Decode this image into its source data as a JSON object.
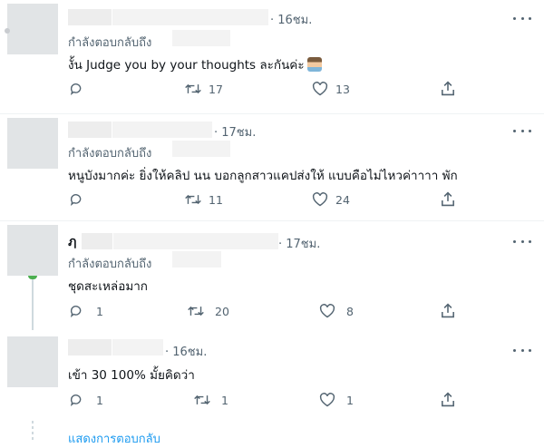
{
  "tweets": [
    {
      "time": "· 16ชม.",
      "replying_to": "กำลังตอบกลับถึง",
      "text": "งั้น Judge you by your thoughts ละกันค่ะ",
      "emoji_icon": "person-gesturing-ok-emoji",
      "replies": "",
      "retweets": "17",
      "likes": "13"
    },
    {
      "time": "· 17ชม.",
      "replying_to": "กำลังตอบกลับถึง",
      "text": "หนูบังมากค่ะ ยิ่งให้คลิป นน บอกลูกสาวแคปส่งให้ แบบคือไม่ไหวค่าาาา พัก",
      "replies": "",
      "retweets": "11",
      "likes": "24"
    },
    {
      "name_glyph": "ฦ",
      "time": "· 17ชม.",
      "replying_to": "กำลังตอบกลับถึง",
      "text": "ชุดสะเหล่อมาก",
      "replies": "1",
      "retweets": "20",
      "likes": "8"
    },
    {
      "time": "· 16ชม.",
      "text": "เข้า 30 100% มั้ยคิดว่า",
      "replies": "1",
      "retweets": "1",
      "likes": "1"
    }
  ],
  "show_replies_label": "แสดงการตอบกลับ"
}
